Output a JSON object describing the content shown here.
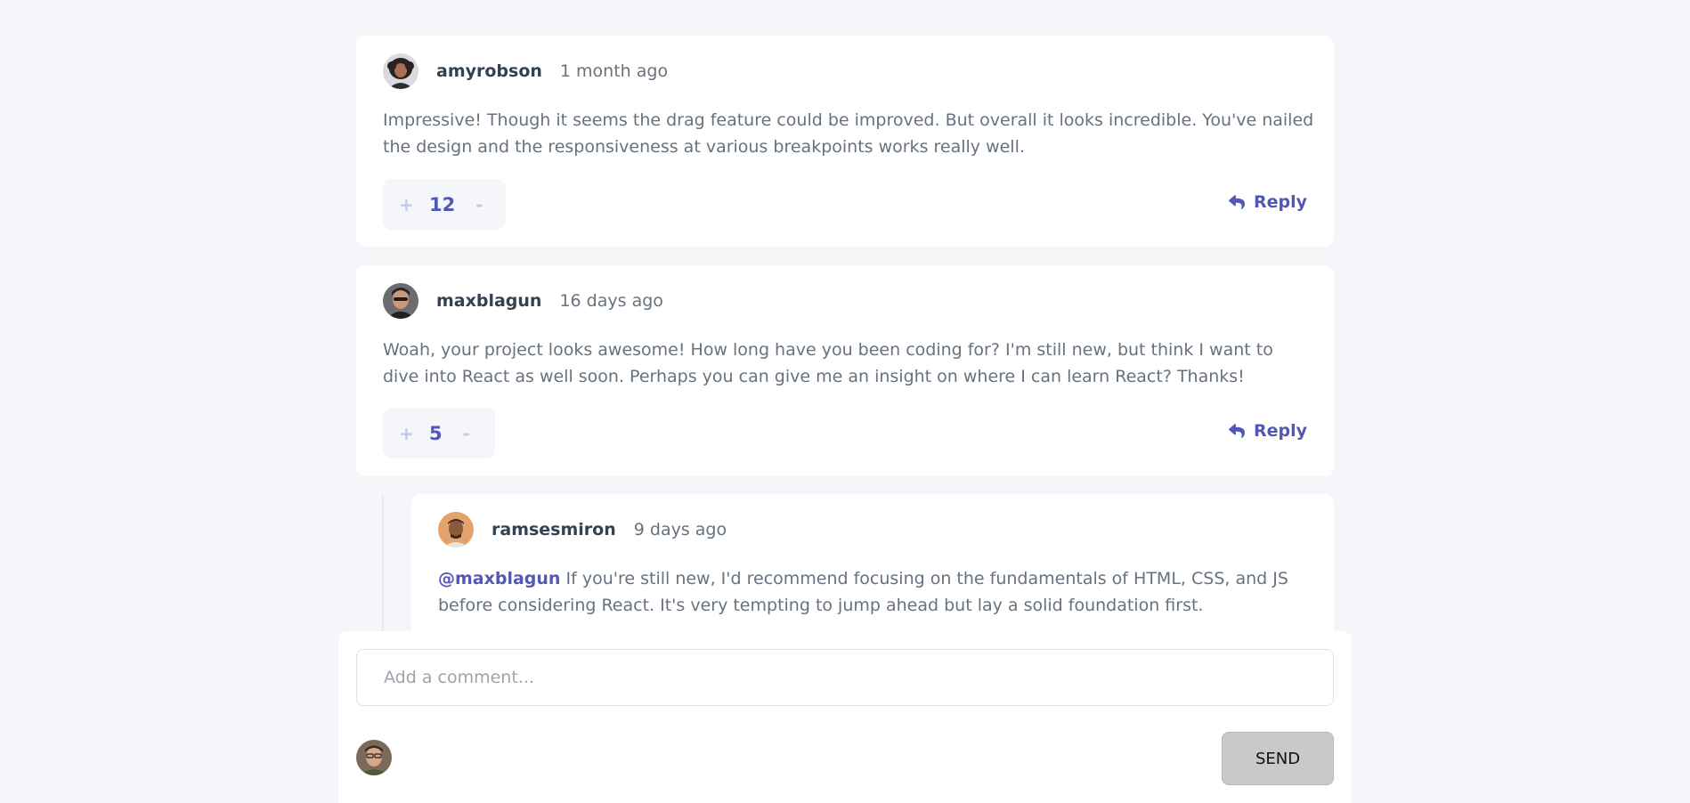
{
  "colors": {
    "page_background": "#f5f6fa",
    "card_background": "#ffffff",
    "accent": "#5357b6",
    "vote_muted": "#c5c6ef",
    "username": "#334253",
    "text": "#67727e",
    "send_button": "#c9c9c9"
  },
  "comments": [
    {
      "username": "amyrobson",
      "created": "1 month ago",
      "content": "Impressive! Though it seems the drag feature could be improved. But overall it looks incredible. You've nailed the design and the responsiveness at various breakpoints works really well.",
      "score": "12",
      "upvote": "+",
      "downvote": "-",
      "reply_label": "Reply",
      "avatar_icon": "avatar-amyrobson-icon"
    },
    {
      "username": "maxblagun",
      "created": "16 days ago",
      "content": "Woah, your project looks awesome! How long have you been coding for? I'm still new, but think I want to dive into React as well soon. Perhaps you can give me an insight on where I can learn React? Thanks!",
      "score": "5",
      "upvote": "+",
      "downvote": "-",
      "reply_label": "Reply",
      "avatar_icon": "avatar-maxblagun-icon",
      "replies": [
        {
          "username": "ramsesmiron",
          "created": "9 days ago",
          "replying_to": "@maxblagun",
          "content": "If you're still new, I'd recommend focusing on the fundamentals of HTML, CSS, and JS before considering React. It's very tempting to jump ahead but lay a solid foundation first.",
          "avatar_icon": "avatar-ramsesmiron-icon"
        }
      ]
    }
  ],
  "composer": {
    "placeholder": "Add a comment...",
    "send_label": "SEND",
    "avatar_icon": "avatar-current-user-icon"
  },
  "icons": {
    "reply": "reply-arrow-icon"
  }
}
